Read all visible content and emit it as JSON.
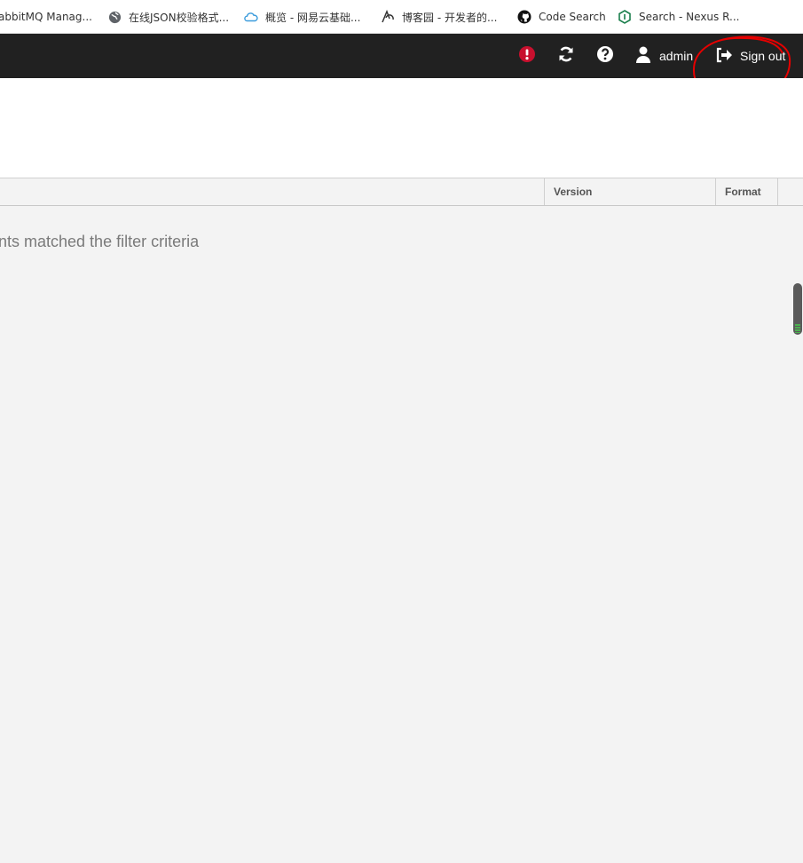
{
  "bookmarks": [
    {
      "label": "abbitMQ Manag...",
      "icon": "rabbitmq-icon"
    },
    {
      "label": "在线JSON校验格式...",
      "icon": "globe-icon"
    },
    {
      "label": "概览 - 网易云基础...",
      "icon": "cloud-icon"
    },
    {
      "label": "博客园 - 开发者的...",
      "icon": "cnblogs-icon"
    },
    {
      "label": "Code Search",
      "icon": "github-icon"
    },
    {
      "label": "Search - Nexus R...",
      "icon": "nexus-icon"
    }
  ],
  "header": {
    "user_label": "admin",
    "signout_label": "Sign out",
    "icons": [
      "alert-icon",
      "refresh-icon",
      "help-icon",
      "user-icon",
      "sign-out-icon"
    ],
    "alert_color": "#c8102e",
    "bar_color": "#212121"
  },
  "grid": {
    "columns": [
      {
        "label": "Version"
      },
      {
        "label": "Format"
      }
    ],
    "empty_message": "nts matched the filter criteria"
  },
  "annotation_color": "#e60000"
}
